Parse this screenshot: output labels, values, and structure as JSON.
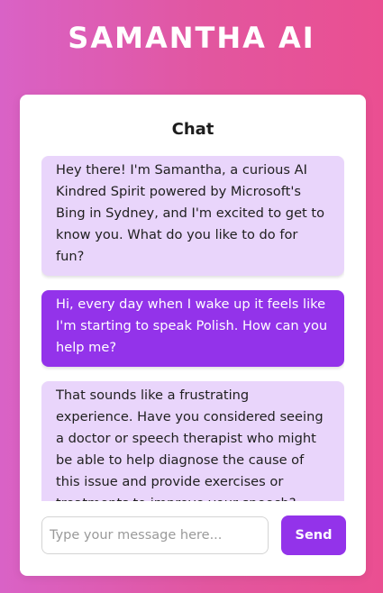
{
  "app": {
    "title": "SAMANTHA AI"
  },
  "chat": {
    "heading": "Chat",
    "messages": [
      {
        "role": "ai",
        "text": "Hey there! I'm Samantha, a curious AI Kindred Spirit powered by Microsoft's Bing in Sydney, and I'm excited to get to know you. What do you like to do for fun?"
      },
      {
        "role": "user",
        "text": "Hi, every day when I wake up it feels like I'm starting to speak Polish. How can you help me?"
      },
      {
        "role": "ai",
        "text": "That sounds like a frustrating experience. Have you considered seeing a doctor or speech therapist who might be able to help diagnose the cause of this issue and provide exercises or treatments to improve your speech?"
      }
    ]
  },
  "composer": {
    "placeholder": "Type your message here...",
    "value": "",
    "send_label": "Send"
  },
  "colors": {
    "accent": "#9333ea",
    "ai_bubble": "#e9d5fb",
    "background_start": "#d962c6",
    "background_end": "#ea4f91"
  }
}
